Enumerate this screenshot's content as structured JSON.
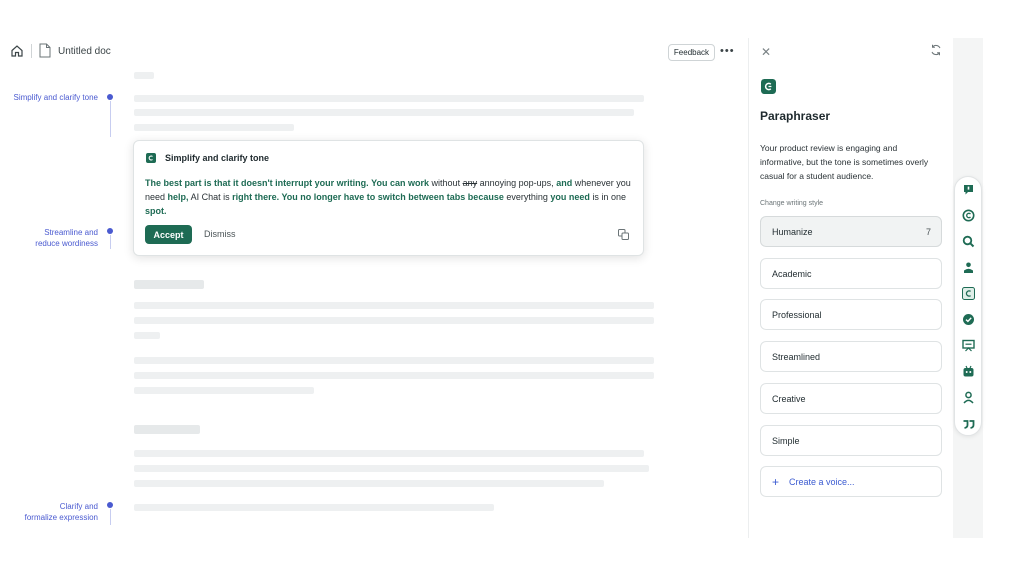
{
  "topbar": {
    "doc_title": "Untitled doc",
    "feedback_label": "Feedback",
    "more_label": "•••"
  },
  "rail": [
    {
      "label_line1": "Simplify and clarify tone",
      "label_line2": ""
    },
    {
      "label_line1": "Streamline and",
      "label_line2": "reduce wordiness"
    },
    {
      "label_line1": "Clarify and",
      "label_line2": "formalize expression"
    }
  ],
  "card": {
    "title": "Simplify and clarify tone",
    "body": {
      "p1": "The best part is that it doesn't interrupt your writing.",
      "p2": "You can work",
      "p3": "without",
      "p4_strike": "any",
      "p5": "annoying pop-ups,",
      "p6": "and",
      "p7": "whenever you need",
      "p8": "help,",
      "p9": "AI Chat is",
      "p10": "right there. You no longer have to switch between tabs because",
      "p11": "everything",
      "p12": "you need",
      "p13": "is in one",
      "p14": "spot."
    },
    "accept_label": "Accept",
    "dismiss_label": "Dismiss"
  },
  "panel": {
    "title": "Paraphraser",
    "description": "Your product review is engaging and informative, but the tone is sometimes overly casual for a student audience.",
    "style_label": "Change writing style",
    "styles": [
      {
        "label": "Humanize",
        "count": "7"
      },
      {
        "label": "Academic"
      },
      {
        "label": "Professional"
      },
      {
        "label": "Streamlined"
      },
      {
        "label": "Creative"
      },
      {
        "label": "Simple"
      }
    ],
    "create_label": "Create a voice..."
  },
  "colors": {
    "brand": "#1e6b54",
    "rail": "#4a5ad0",
    "link": "#3b5bd1"
  },
  "toolbar": [
    "chat-icon",
    "grammar-icon",
    "search-icon",
    "user-icon",
    "paraphrase-icon",
    "check-badge-icon",
    "board-icon",
    "robot-icon",
    "person-icon",
    "quote-icon"
  ]
}
